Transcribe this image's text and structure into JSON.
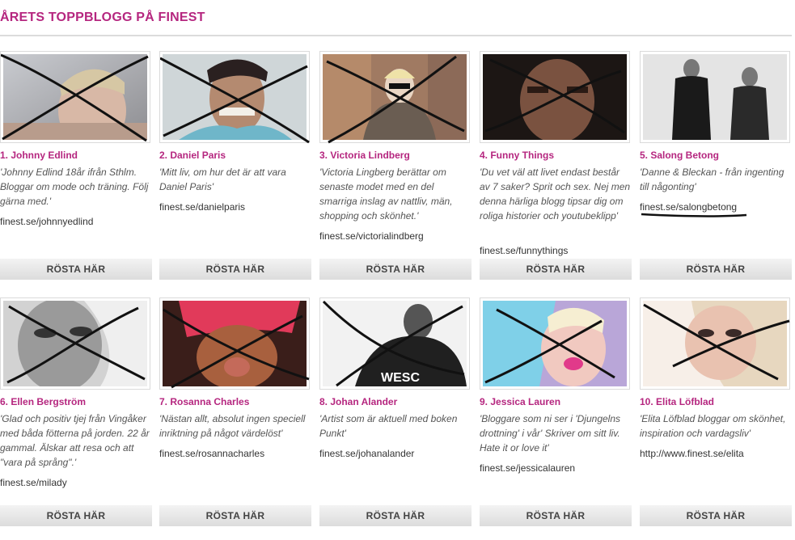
{
  "header": {
    "title": "ÅRETS TOPPBLOGG PÅ FINEST"
  },
  "blogs": [
    {
      "name": "1. Johnny Edlind",
      "desc": "'Johnny Edlind 18år ifrån Sthlm. Bloggar om mode och träning. Följ gärna med.'",
      "url": "finest.se/johnnyedlind",
      "vote": "RÖSTA HÄR",
      "crossed": true
    },
    {
      "name": "2. Daniel Paris",
      "desc": "'Mitt liv, om hur det är att vara Daniel Paris'",
      "url": "finest.se/danielparis",
      "vote": "RÖSTA HÄR",
      "crossed": true
    },
    {
      "name": "3. Victoria Lindberg",
      "desc": "'Victoria Lingberg berättar om senaste modet med en del smarriga inslag av nattliv, män, shopping och skönhet.'",
      "url": "finest.se/victorialindberg",
      "vote": "RÖSTA HÄR",
      "crossed": true
    },
    {
      "name": "4. Funny Things",
      "desc": "'Du vet väl att livet endast består av 7 saker? Sprit och sex. Nej men denna härliga blogg tipsar dig om roliga historier och youtubeklipp'",
      "url": "finest.se/funnythings",
      "vote": "RÖSTA HÄR",
      "crossed": true
    },
    {
      "name": "5. Salong Betong",
      "desc": "'Danne & Bleckan - från ingenting till någonting'",
      "url": "finest.se/salongbetong",
      "vote": "RÖSTA HÄR",
      "crossed": false
    },
    {
      "name": "6. Ellen Bergström",
      "desc": "'Glad och positiv tjej från Vingåker med båda fötterna på jorden. 22 år gammal. Älskar att resa och att \"vara på språng\".'",
      "url": "finest.se/milady",
      "vote": "RÖSTA HÄR",
      "crossed": true
    },
    {
      "name": "7. Rosanna Charles",
      "desc": "'Nästan allt, absolut ingen speciell inriktning på något värdelöst'",
      "url": "finest.se/rosannacharles",
      "vote": "RÖSTA HÄR",
      "crossed": true
    },
    {
      "name": "8. Johan Alander",
      "desc": "'Artist som är aktuell med boken Punkt'",
      "url": "finest.se/johanalander",
      "vote": "RÖSTA HÄR",
      "crossed": true,
      "photo_text": "WESC"
    },
    {
      "name": "9. Jessica Lauren",
      "desc": "'Bloggare som ni ser i 'Djungelns drottning' i vår' Skriver om sitt liv. Hate it or love it'",
      "url": "finest.se/jessicalauren",
      "vote": "RÖSTA HÄR",
      "crossed": true
    },
    {
      "name": "10. Elita Löfblad",
      "desc": "'Elita Löfblad bloggar om skönhet, inspiration och vardagsliv'",
      "url": "http://www.finest.se/elita",
      "vote": "RÖSTA HÄR",
      "crossed": true
    }
  ],
  "colors": {
    "accent": "#b5267f",
    "button_top": "#f3f3f3",
    "button_bottom": "#dcdcdc",
    "rule": "#dcdcdc"
  }
}
